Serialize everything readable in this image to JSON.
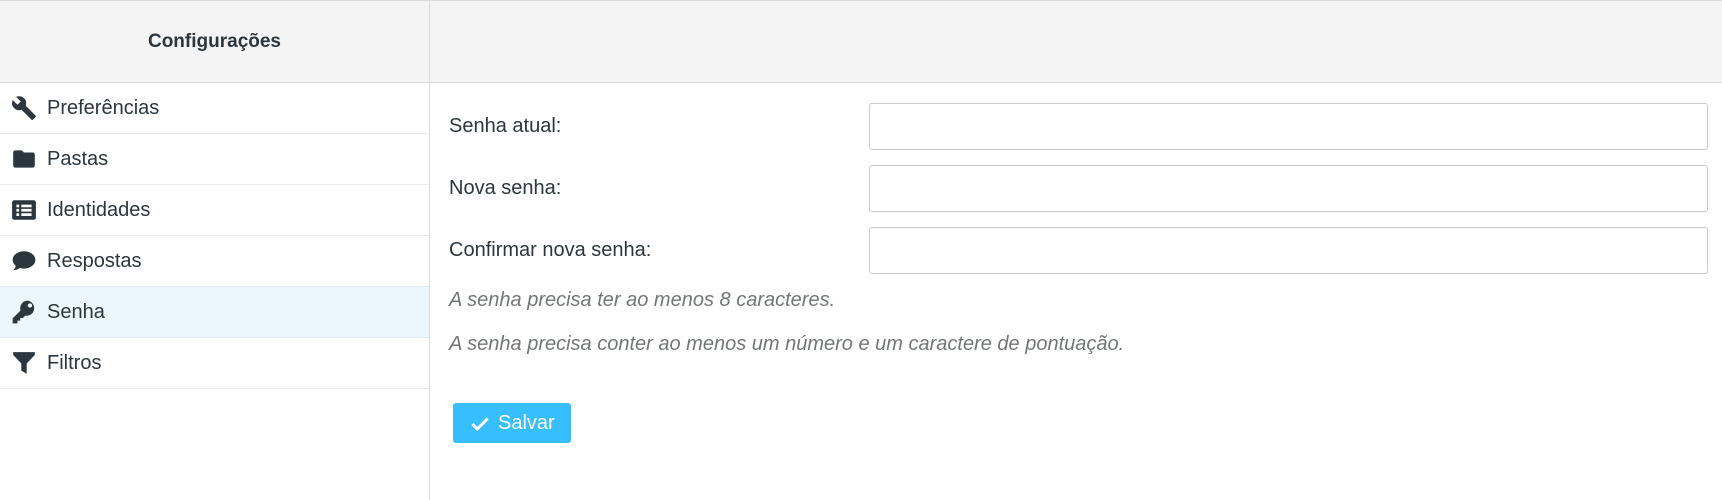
{
  "sidebar": {
    "title": "Configurações",
    "items": [
      {
        "label": "Preferências",
        "icon": "wrench-icon",
        "selected": false
      },
      {
        "label": "Pastas",
        "icon": "folder-icon",
        "selected": false
      },
      {
        "label": "Identidades",
        "icon": "list-icon",
        "selected": false
      },
      {
        "label": "Respostas",
        "icon": "comment-icon",
        "selected": false
      },
      {
        "label": "Senha",
        "icon": "key-icon",
        "selected": true
      },
      {
        "label": "Filtros",
        "icon": "filter-icon",
        "selected": false
      }
    ]
  },
  "form": {
    "current_password_label": "Senha atual:",
    "current_password_value": "",
    "new_password_label": "Nova senha:",
    "new_password_value": "",
    "confirm_password_label": "Confirmar nova senha:",
    "confirm_password_value": "",
    "hint_min_length": "A senha precisa ter ao menos 8 caracteres.",
    "hint_complexity": "A senha precisa conter ao menos um número e um caractere de pontuação.",
    "save_label": "Salvar"
  },
  "colors": {
    "accent": "#37beff",
    "selected_bg": "#ebf7fd",
    "header_bg": "#f4f4f4",
    "text": "#2c363f",
    "hint_text": "#737677"
  }
}
